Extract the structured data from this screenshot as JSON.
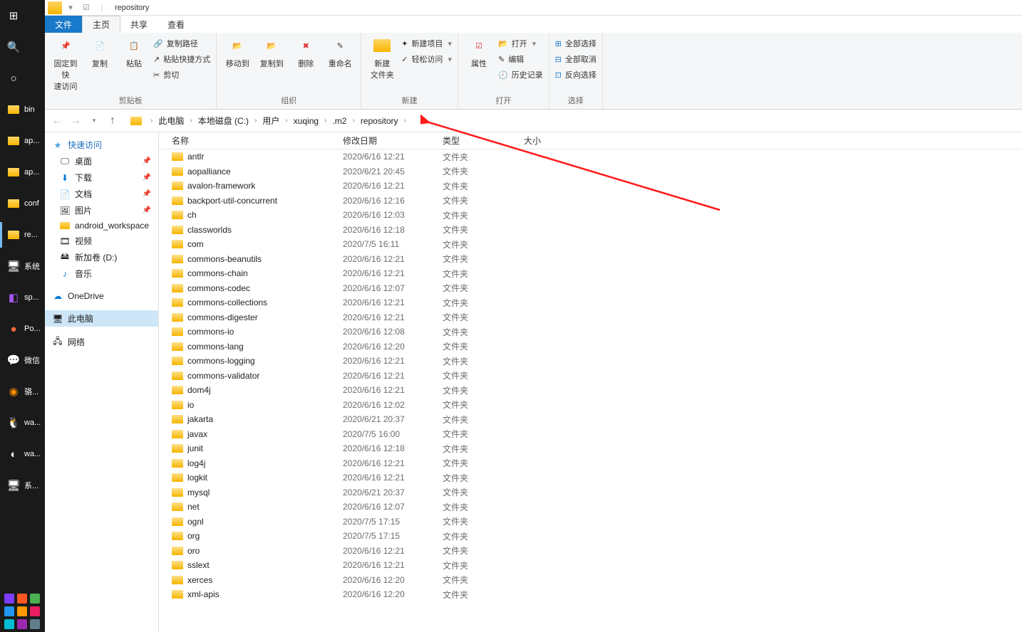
{
  "window": {
    "title": "repository"
  },
  "tabs": {
    "file": "文件",
    "home": "主页",
    "share": "共享",
    "view": "查看"
  },
  "ribbon": {
    "group1": {
      "pin": "固定到快\n速访问",
      "copy": "复制",
      "paste": "粘贴",
      "copypath": "复制路径",
      "pasteshortcut": "粘贴快捷方式",
      "cut": "剪切",
      "label": "剪贴板"
    },
    "group2": {
      "moveto": "移动到",
      "copyto": "复制到",
      "delete": "删除",
      "rename": "重命名",
      "label": "组织"
    },
    "group3": {
      "newfolder": "新建\n文件夹",
      "newitem": "新建项目",
      "easyaccess": "轻松访问",
      "label": "新建"
    },
    "group4": {
      "properties": "属性",
      "open": "打开",
      "edit": "编辑",
      "history": "历史记录",
      "label": "打开"
    },
    "group5": {
      "selectall": "全部选择",
      "selectnone": "全部取消",
      "invert": "反向选择",
      "label": "选择"
    }
  },
  "breadcrumb": [
    "此电脑",
    "本地磁盘 (C:)",
    "用户",
    "xuqing",
    ".m2",
    "repository"
  ],
  "sidepanel": {
    "quick": "快速访问",
    "items": [
      {
        "label": "桌面",
        "pin": true,
        "icon": "desktop"
      },
      {
        "label": "下载",
        "pin": true,
        "icon": "download"
      },
      {
        "label": "文档",
        "pin": true,
        "icon": "doc"
      },
      {
        "label": "图片",
        "pin": true,
        "icon": "pic"
      },
      {
        "label": "android_workspace",
        "icon": "folder"
      },
      {
        "label": "视频",
        "icon": "video"
      },
      {
        "label": "新加卷 (D:)",
        "icon": "drive"
      },
      {
        "label": "音乐",
        "icon": "music"
      }
    ],
    "onedrive": "OneDrive",
    "thispc": "此电脑",
    "network": "网络"
  },
  "columns": {
    "name": "名称",
    "date": "修改日期",
    "type": "类型",
    "size": "大小"
  },
  "rows": [
    {
      "name": "antlr",
      "date": "2020/6/16 12:21",
      "type": "文件夹"
    },
    {
      "name": "aopalliance",
      "date": "2020/6/21 20:45",
      "type": "文件夹"
    },
    {
      "name": "avalon-framework",
      "date": "2020/6/16 12:21",
      "type": "文件夹"
    },
    {
      "name": "backport-util-concurrent",
      "date": "2020/6/16 12:16",
      "type": "文件夹"
    },
    {
      "name": "ch",
      "date": "2020/6/16 12:03",
      "type": "文件夹"
    },
    {
      "name": "classworlds",
      "date": "2020/6/16 12:18",
      "type": "文件夹"
    },
    {
      "name": "com",
      "date": "2020/7/5 16:11",
      "type": "文件夹"
    },
    {
      "name": "commons-beanutils",
      "date": "2020/6/16 12:21",
      "type": "文件夹"
    },
    {
      "name": "commons-chain",
      "date": "2020/6/16 12:21",
      "type": "文件夹"
    },
    {
      "name": "commons-codec",
      "date": "2020/6/16 12:07",
      "type": "文件夹"
    },
    {
      "name": "commons-collections",
      "date": "2020/6/16 12:21",
      "type": "文件夹"
    },
    {
      "name": "commons-digester",
      "date": "2020/6/16 12:21",
      "type": "文件夹"
    },
    {
      "name": "commons-io",
      "date": "2020/6/16 12:08",
      "type": "文件夹"
    },
    {
      "name": "commons-lang",
      "date": "2020/6/16 12:20",
      "type": "文件夹"
    },
    {
      "name": "commons-logging",
      "date": "2020/6/16 12:21",
      "type": "文件夹"
    },
    {
      "name": "commons-validator",
      "date": "2020/6/16 12:21",
      "type": "文件夹"
    },
    {
      "name": "dom4j",
      "date": "2020/6/16 12:21",
      "type": "文件夹"
    },
    {
      "name": "io",
      "date": "2020/6/16 12:02",
      "type": "文件夹"
    },
    {
      "name": "jakarta",
      "date": "2020/6/21 20:37",
      "type": "文件夹"
    },
    {
      "name": "javax",
      "date": "2020/7/5 16:00",
      "type": "文件夹"
    },
    {
      "name": "junit",
      "date": "2020/6/16 12:18",
      "type": "文件夹"
    },
    {
      "name": "log4j",
      "date": "2020/6/16 12:21",
      "type": "文件夹"
    },
    {
      "name": "logkit",
      "date": "2020/6/16 12:21",
      "type": "文件夹"
    },
    {
      "name": "mysql",
      "date": "2020/6/21 20:37",
      "type": "文件夹"
    },
    {
      "name": "net",
      "date": "2020/6/16 12:07",
      "type": "文件夹"
    },
    {
      "name": "ognl",
      "date": "2020/7/5 17:15",
      "type": "文件夹"
    },
    {
      "name": "org",
      "date": "2020/7/5 17:15",
      "type": "文件夹"
    },
    {
      "name": "oro",
      "date": "2020/6/16 12:21",
      "type": "文件夹"
    },
    {
      "name": "sslext",
      "date": "2020/6/16 12:21",
      "type": "文件夹"
    },
    {
      "name": "xerces",
      "date": "2020/6/16 12:20",
      "type": "文件夹"
    },
    {
      "name": "xml-apis",
      "date": "2020/6/16 12:20",
      "type": "文件夹"
    }
  ],
  "taskbar": [
    {
      "label": "",
      "icon": "win"
    },
    {
      "label": "",
      "icon": "search"
    },
    {
      "label": "",
      "icon": "cortana"
    },
    {
      "label": "bin",
      "icon": "folder"
    },
    {
      "label": "ap...",
      "icon": "folder"
    },
    {
      "label": "ap...",
      "icon": "folder"
    },
    {
      "label": "conf",
      "icon": "folder"
    },
    {
      "label": "re...",
      "icon": "folder",
      "active": true
    },
    {
      "label": "系统",
      "icon": "pc"
    },
    {
      "label": "sp...",
      "icon": "idea"
    },
    {
      "label": "Po...",
      "icon": "postman"
    },
    {
      "label": "微信",
      "icon": "wechat"
    },
    {
      "label": "骆...",
      "icon": "isp"
    },
    {
      "label": "wa...",
      "icon": "qq"
    },
    {
      "label": "wa...",
      "icon": "app"
    },
    {
      "label": "系...",
      "icon": "pc2"
    }
  ]
}
